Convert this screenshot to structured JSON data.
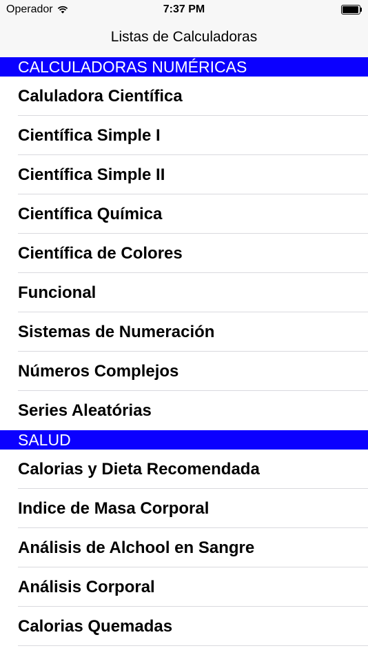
{
  "status_bar": {
    "carrier": "Operador",
    "time": "7:37 PM",
    "icons": [
      "wifi-icon",
      "battery-icon"
    ]
  },
  "nav": {
    "title": "Listas de Calculadoras"
  },
  "sections": [
    {
      "header": "CALCULADORAS NUMÉRICAS",
      "items": [
        "Caluladora Científica",
        "Científica Simple I",
        "Científica Simple II",
        "Científica Química",
        "Científica de Colores",
        "Funcional",
        "Sistemas de Numeración",
        "Números Complejos",
        "Series Aleatórias"
      ]
    },
    {
      "header": "SALUD",
      "items": [
        "Calorias y Dieta Recomendada",
        "Indice de Masa Corporal",
        "Análisis de Alchool en Sangre",
        "Análisis Corporal",
        "Calorias Quemadas"
      ]
    }
  ],
  "colors": {
    "section_header_bg": "#0b00ff",
    "section_header_text": "#ffffff",
    "nav_bg": "#f7f7f7",
    "separator": "#d9d9de"
  }
}
